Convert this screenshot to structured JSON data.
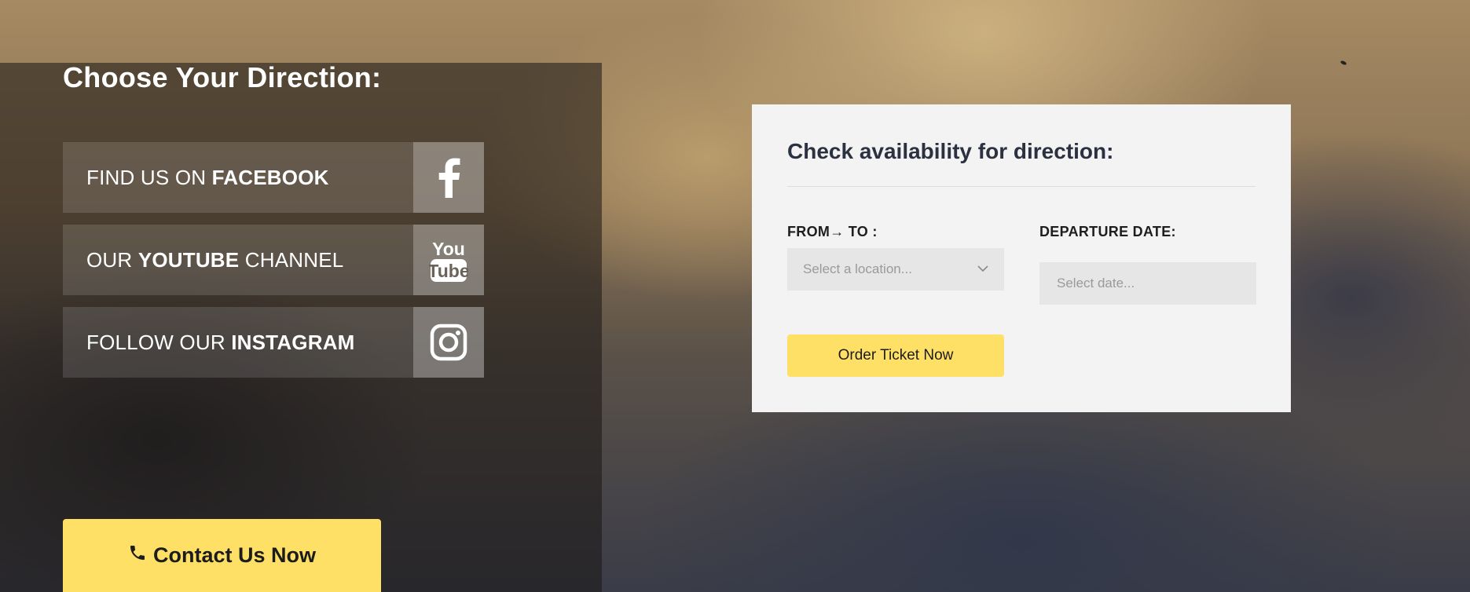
{
  "directions": {
    "title": "Choose Your Direction:",
    "social": [
      {
        "prefix": "FIND US ON ",
        "bold": "FACEBOOK",
        "suffix": "",
        "icon": "facebook-icon"
      },
      {
        "prefix": "OUR ",
        "bold": "YOUTUBE",
        "suffix": " CHANNEL",
        "icon": "youtube-icon",
        "icon_text_top": "You",
        "icon_text_bottom": "Tube"
      },
      {
        "prefix": "FOLLOW OUR ",
        "bold": "INSTAGRAM",
        "suffix": "",
        "icon": "instagram-icon"
      }
    ],
    "contact_button": {
      "label": "Contact Us Now",
      "icon": "phone-icon"
    }
  },
  "availability": {
    "title": "Check availability for direction:",
    "from_to_label": "FROM→ TO :",
    "location_placeholder": "Select a location...",
    "departure_label": "DEPARTURE DATE:",
    "date_placeholder": "Select date...",
    "order_button": "Order Ticket Now"
  },
  "colors": {
    "accent_yellow": "#ffe066",
    "card_bg": "#f3f3f3",
    "title_dark": "#2b3140"
  }
}
